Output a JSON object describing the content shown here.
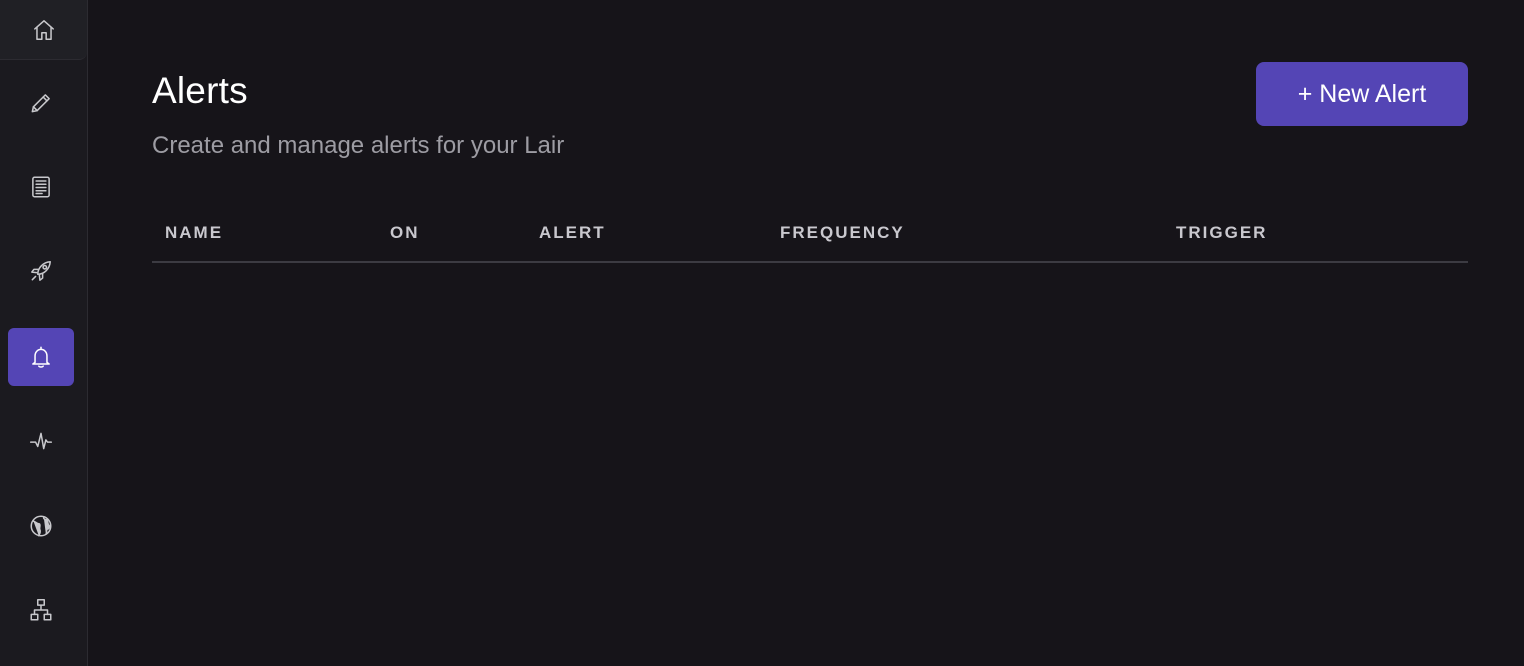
{
  "sidebar": {
    "items": [
      {
        "name": "home",
        "icon": "home-icon"
      },
      {
        "name": "edit",
        "icon": "pencil-icon"
      },
      {
        "name": "docs",
        "icon": "document-icon"
      },
      {
        "name": "deploy",
        "icon": "rocket-icon"
      },
      {
        "name": "alerts",
        "icon": "bell-icon",
        "active": true
      },
      {
        "name": "activity",
        "icon": "pulse-icon"
      },
      {
        "name": "web",
        "icon": "globe-icon"
      },
      {
        "name": "hierarchy",
        "icon": "sitemap-icon"
      }
    ]
  },
  "header": {
    "title": "Alerts",
    "subtitle": "Create and manage alerts for your Lair",
    "new_button_label": "+ New Alert"
  },
  "table": {
    "columns": [
      "NAME",
      "ON",
      "ALERT",
      "FREQUENCY",
      "TRIGGER"
    ],
    "rows": []
  },
  "colors": {
    "accent": "#5445b5",
    "background": "#161419",
    "sidebar": "#1b1a1f"
  }
}
